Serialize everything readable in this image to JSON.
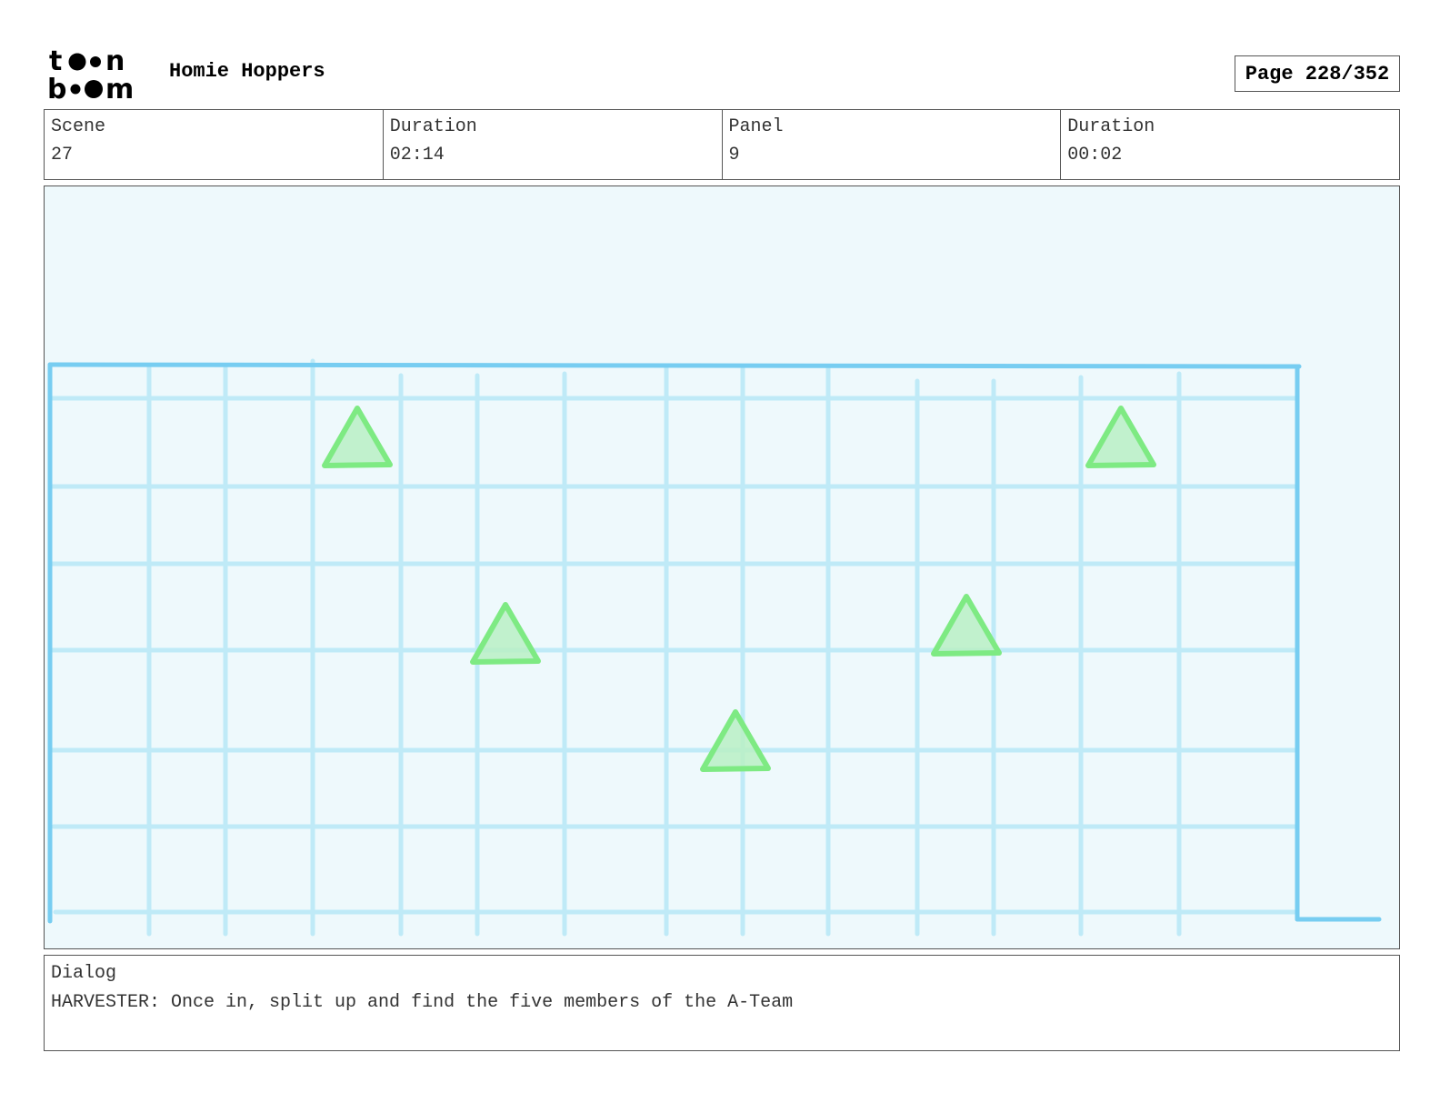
{
  "header": {
    "logo_text": "toon boom",
    "project_title": "Homie Hoppers",
    "page_label": "Page 228/352"
  },
  "info": {
    "scene_label": "Scene",
    "scene_value": "27",
    "scene_duration_label": "Duration",
    "scene_duration_value": "02:14",
    "panel_label": "Panel",
    "panel_value": "9",
    "panel_duration_label": "Duration",
    "panel_duration_value": "00:02"
  },
  "dialog": {
    "label": "Dialog",
    "text": "HARVESTER: Once in, split up and find the five members of the A-Team"
  },
  "sketch": {
    "markers": [
      {
        "name": "a-team-member-marker-1"
      },
      {
        "name": "a-team-member-marker-2"
      },
      {
        "name": "a-team-member-marker-3"
      },
      {
        "name": "a-team-member-marker-4"
      },
      {
        "name": "a-team-member-marker-5"
      }
    ],
    "colors": {
      "background": "#eef9fc",
      "grid": "#bfeaf7",
      "outline": "#77cdf1",
      "marker_stroke": "#7eea83",
      "marker_fill": "#b8f0c4"
    }
  }
}
